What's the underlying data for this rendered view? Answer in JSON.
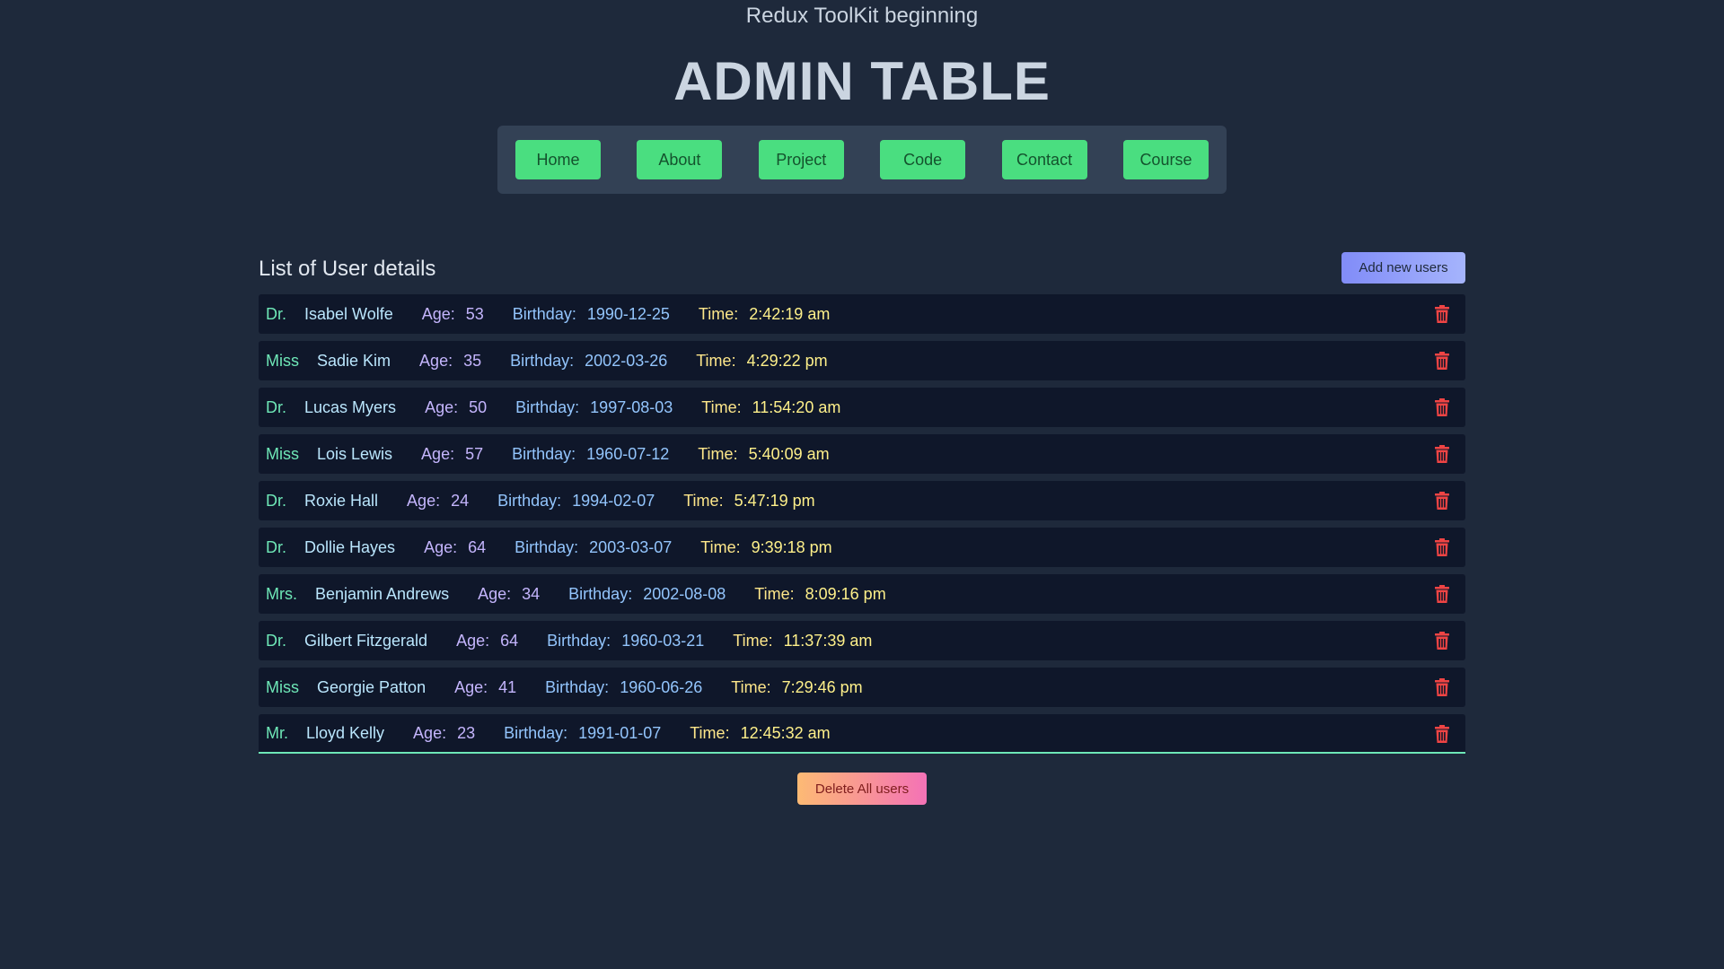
{
  "header": {
    "subtitle": "Redux ToolKit beginning",
    "title": "ADMIN TABLE"
  },
  "nav": [
    {
      "label": "Home"
    },
    {
      "label": "About"
    },
    {
      "label": "Project"
    },
    {
      "label": "Code"
    },
    {
      "label": "Contact"
    },
    {
      "label": "Course"
    }
  ],
  "list": {
    "title": "List of User details",
    "add_button": "Add new users",
    "delete_all_button": "Delete All users",
    "labels": {
      "age": "Age:",
      "birthday": "Birthday:",
      "time": "Time:"
    },
    "users": [
      {
        "title": "Dr.",
        "name": "Isabel Wolfe",
        "age": "53",
        "birthday": "1990-12-25",
        "time": "2:42:19 am"
      },
      {
        "title": "Miss",
        "name": "Sadie Kim",
        "age": "35",
        "birthday": "2002-03-26",
        "time": "4:29:22 pm"
      },
      {
        "title": "Dr.",
        "name": "Lucas Myers",
        "age": "50",
        "birthday": "1997-08-03",
        "time": "11:54:20 am"
      },
      {
        "title": "Miss",
        "name": "Lois Lewis",
        "age": "57",
        "birthday": "1960-07-12",
        "time": "5:40:09 am"
      },
      {
        "title": "Dr.",
        "name": "Roxie Hall",
        "age": "24",
        "birthday": "1994-02-07",
        "time": "5:47:19 pm"
      },
      {
        "title": "Dr.",
        "name": "Dollie Hayes",
        "age": "64",
        "birthday": "2003-03-07",
        "time": "9:39:18 pm"
      },
      {
        "title": "Mrs.",
        "name": "Benjamin Andrews",
        "age": "34",
        "birthday": "2002-08-08",
        "time": "8:09:16 pm"
      },
      {
        "title": "Dr.",
        "name": "Gilbert Fitzgerald",
        "age": "64",
        "birthday": "1960-03-21",
        "time": "11:37:39 am"
      },
      {
        "title": "Miss",
        "name": "Georgie Patton",
        "age": "41",
        "birthday": "1960-06-26",
        "time": "7:29:46 pm"
      },
      {
        "title": "Mr.",
        "name": "Lloyd Kelly",
        "age": "23",
        "birthday": "1991-01-07",
        "time": "12:45:32 am"
      }
    ]
  },
  "colors": {
    "background": "#1e293b",
    "nav_button": "#4ade80",
    "row_background": "#0f172a",
    "trash_icon": "#ef4444"
  }
}
